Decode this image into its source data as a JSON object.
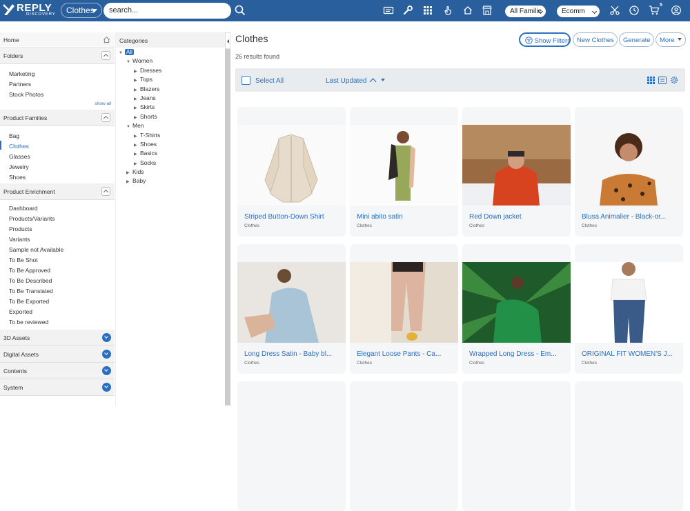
{
  "app": {
    "logo_text": "REPLY",
    "logo_sub": "DISCOVERY"
  },
  "topbar": {
    "category_select": "Clothes",
    "search_placeholder": "search...",
    "family_select": "All Familie",
    "channel_select": "Ecomm",
    "cart_count": "5"
  },
  "left": {
    "home": "Home",
    "folders": {
      "title": "Folders",
      "items": [
        "Marketing",
        "Partners",
        "Stock Photos"
      ],
      "show_all": "show all"
    },
    "families": {
      "title": "Product Families",
      "items": [
        "Bag",
        "Clothes",
        "Glasses",
        "Jewelry",
        "Shoes"
      ],
      "active": "Clothes"
    },
    "enrichment": {
      "title": "Product Enrichment",
      "items": [
        "Dashboard",
        "Products/Variants",
        "Products",
        "Variants",
        "Sample not Available",
        "To Be Shot",
        "To Be Approved",
        "To Be Described",
        "To Be Translated",
        "To Be Exported",
        "Exported",
        "To be reviewed"
      ]
    },
    "sections": [
      "3D Assets",
      "Digital Assets",
      "Contents",
      "System"
    ]
  },
  "categories": {
    "title": "Categories",
    "tree": [
      {
        "label": "All",
        "depth": 0,
        "arrow": "down",
        "selected": true
      },
      {
        "label": "Women",
        "depth": 1,
        "arrow": "down"
      },
      {
        "label": "Dresses",
        "depth": 2,
        "arrow": "right"
      },
      {
        "label": "Tops",
        "depth": 2,
        "arrow": "right"
      },
      {
        "label": "Blazers",
        "depth": 2,
        "arrow": "right"
      },
      {
        "label": "Jeans",
        "depth": 2,
        "arrow": "right"
      },
      {
        "label": "Skirts",
        "depth": 2,
        "arrow": "right"
      },
      {
        "label": "Shorts",
        "depth": 2,
        "arrow": "right"
      },
      {
        "label": "Men",
        "depth": 1,
        "arrow": "down"
      },
      {
        "label": "T-Shirts",
        "depth": 2,
        "arrow": "right"
      },
      {
        "label": "Shoes",
        "depth": 2,
        "arrow": "right"
      },
      {
        "label": "Basics",
        "depth": 2,
        "arrow": "right"
      },
      {
        "label": "Socks",
        "depth": 2,
        "arrow": "right"
      },
      {
        "label": "Kids",
        "depth": 1,
        "arrow": "right"
      },
      {
        "label": "Baby",
        "depth": 1,
        "arrow": "right"
      }
    ]
  },
  "main": {
    "title": "Clothes",
    "results": "26 results found",
    "buttons": {
      "show_filters": "Show Filters",
      "new": "New Clothes",
      "generate": "Generate",
      "more": "More"
    },
    "select_all": "Select All",
    "sort": "Last Updated",
    "products": [
      {
        "name": "Striped Button-Down Shirt",
        "category": "Clothes"
      },
      {
        "name": "Mini abito satin",
        "category": "Clothes"
      },
      {
        "name": "Red Down jacket",
        "category": "Clothes"
      },
      {
        "name": "Blusa Animalier - Black-or...",
        "category": "Clothes"
      },
      {
        "name": "Long Dress Satin - Baby bl...",
        "category": "Clothes"
      },
      {
        "name": "Elegant Loose Pants - Ca...",
        "category": "Clothes"
      },
      {
        "name": "Wrapped Long Dress - Em...",
        "category": "Clothes"
      },
      {
        "name": "ORIGINAL FIT WOMEN'S J...",
        "category": "Clothes"
      }
    ]
  },
  "colors": {
    "brand": "#2a5f9e",
    "accent": "#2a6fc0"
  }
}
